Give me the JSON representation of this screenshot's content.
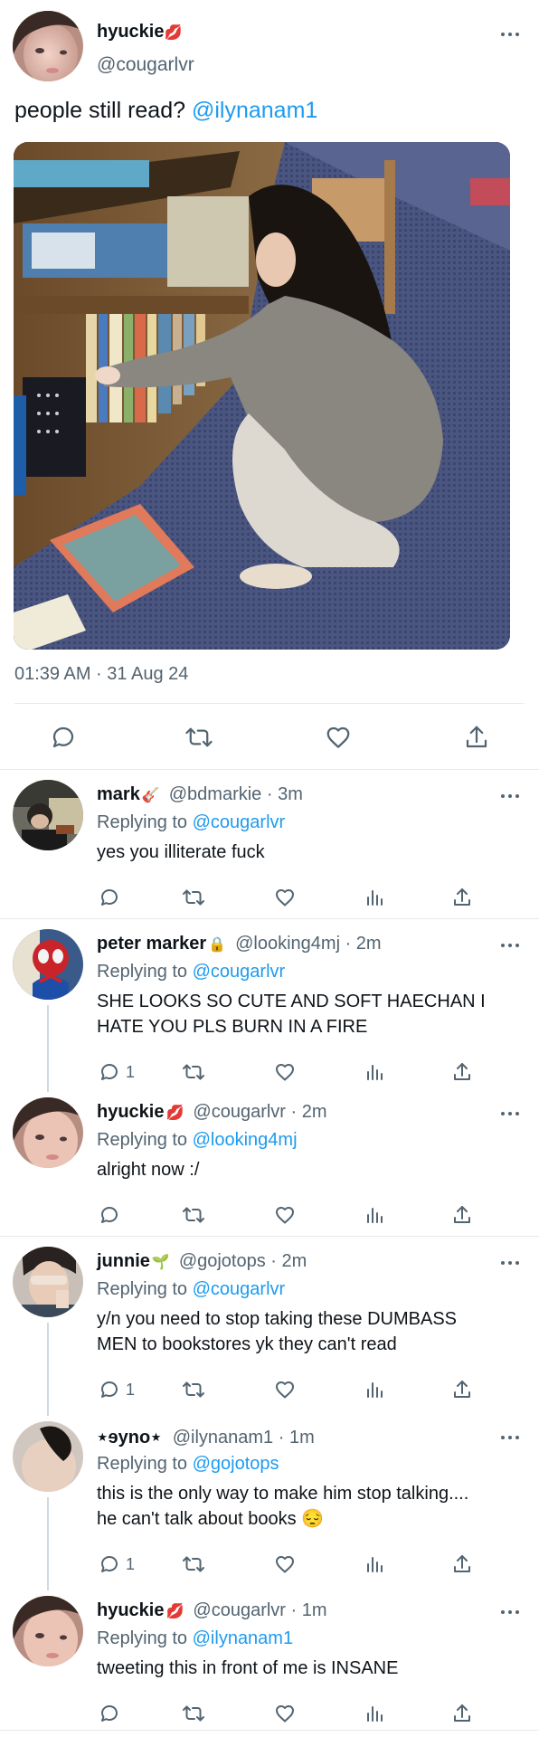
{
  "main_tweet": {
    "display_name": "hyuckie",
    "name_emoji": "💋",
    "handle": "@cougarlvr",
    "text": "people still read? ",
    "mention": "@ilynanam1",
    "timestamp": "01:39 AM · 31 Aug 24",
    "icons": [
      "reply-icon",
      "retweet-icon",
      "like-icon",
      "share-icon"
    ]
  },
  "replies": [
    {
      "display_name": "mark",
      "name_emoji": "🎸",
      "handle_time": "@bdmarkie · 3m",
      "replying_prefix": "Replying to ",
      "replying_to": "@cougarlvr",
      "text_lines": [
        "yes you illiterate fuck"
      ],
      "reply_count": ""
    },
    {
      "display_name": "peter marker",
      "name_emoji": "🔒",
      "handle_time": "@looking4mj · 2m",
      "replying_prefix": "Replying to ",
      "replying_to": "@cougarlvr",
      "text_lines": [
        "SHE LOOKS SO CUTE AND SOFT HAECHAN I",
        "HATE YOU PLS BURN IN A FIRE"
      ],
      "reply_count": "1"
    },
    {
      "display_name": "hyuckie",
      "name_emoji": "💋",
      "handle_time": "@cougarlvr · 2m",
      "replying_prefix": "Replying to ",
      "replying_to": "@looking4mj",
      "text_lines": [
        "alright now :/"
      ],
      "reply_count": ""
    },
    {
      "display_name": "junnie",
      "name_emoji": "🌱",
      "handle_time": "@gojotops · 2m",
      "replying_prefix": "Replying to ",
      "replying_to": "@cougarlvr",
      "text_lines": [
        "y/n you need to stop taking these DUMBASS",
        "MEN to bookstores yk they can't read"
      ],
      "reply_count": "1"
    },
    {
      "display_name": "⋆ɘyno⋆",
      "name_emoji": "",
      "handle_time": "@ilynanam1 · 1m",
      "replying_prefix": "Replying to ",
      "replying_to": "@gojotops",
      "text_lines": [
        "this is the only way to make him stop talking....",
        "he can't talk about books 😔"
      ],
      "reply_count": "1"
    },
    {
      "display_name": "hyuckie",
      "name_emoji": "💋",
      "handle_time": "@cougarlvr · 1m",
      "replying_prefix": "Replying to ",
      "replying_to": "@ilynanam1",
      "text_lines": [
        "tweeting this in front of me is INSANE"
      ],
      "reply_count": ""
    }
  ],
  "colors": {
    "link": "#1d9bf0",
    "secondary_text": "#536471",
    "divider": "#e6e9ec"
  }
}
